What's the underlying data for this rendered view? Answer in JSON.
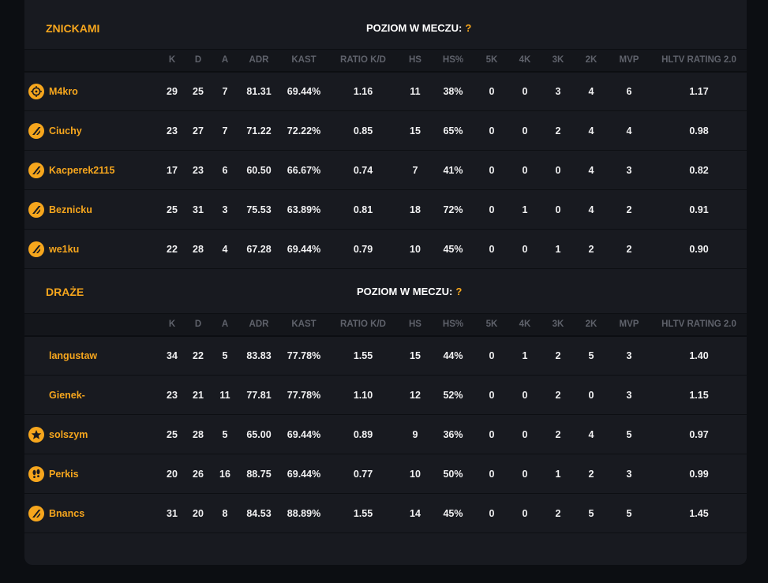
{
  "columns": [
    "K",
    "D",
    "A",
    "ADR",
    "KAST",
    "RATIO K/D",
    "HS",
    "HS%",
    "5K",
    "4K",
    "3K",
    "2K",
    "MVP",
    "HLTV RATING 2.0"
  ],
  "teams": [
    {
      "name": "ZNICKAMI",
      "level_label": "POZIOM W MECZU:",
      "level_value": "?",
      "players": [
        {
          "name": "M4kro",
          "icon": "crosshair-icon",
          "stats": [
            "29",
            "25",
            "7",
            "81.31",
            "69.44%",
            "1.16",
            "11",
            "38%",
            "0",
            "0",
            "3",
            "4",
            "6",
            "1.17"
          ]
        },
        {
          "name": "Ciuchy",
          "icon": "slash-badge-icon",
          "stats": [
            "23",
            "27",
            "7",
            "71.22",
            "72.22%",
            "0.85",
            "15",
            "65%",
            "0",
            "0",
            "2",
            "4",
            "4",
            "0.98"
          ]
        },
        {
          "name": "Kacperek2115",
          "icon": "slash-badge-icon",
          "stats": [
            "17",
            "23",
            "6",
            "60.50",
            "66.67%",
            "0.74",
            "7",
            "41%",
            "0",
            "0",
            "0",
            "4",
            "3",
            "0.82"
          ]
        },
        {
          "name": "Beznicku",
          "icon": "slash-badge-icon",
          "stats": [
            "25",
            "31",
            "3",
            "75.53",
            "63.89%",
            "0.81",
            "18",
            "72%",
            "0",
            "1",
            "0",
            "4",
            "2",
            "0.91"
          ]
        },
        {
          "name": "we1ku",
          "icon": "slash-badge-icon",
          "stats": [
            "22",
            "28",
            "4",
            "67.28",
            "69.44%",
            "0.79",
            "10",
            "45%",
            "0",
            "0",
            "1",
            "2",
            "2",
            "0.90"
          ]
        }
      ]
    },
    {
      "name": "DRAŻE",
      "level_label": "POZIOM W MECZU:",
      "level_value": "?",
      "players": [
        {
          "name": "langustaw",
          "icon": "",
          "stats": [
            "34",
            "22",
            "5",
            "83.83",
            "77.78%",
            "1.55",
            "15",
            "44%",
            "0",
            "1",
            "2",
            "5",
            "3",
            "1.40"
          ]
        },
        {
          "name": "Gienek-",
          "icon": "",
          "stats": [
            "23",
            "21",
            "11",
            "77.81",
            "77.78%",
            "1.10",
            "12",
            "52%",
            "0",
            "0",
            "2",
            "0",
            "3",
            "1.15"
          ]
        },
        {
          "name": "solszym",
          "icon": "star-icon",
          "stats": [
            "25",
            "28",
            "5",
            "65.00",
            "69.44%",
            "0.89",
            "9",
            "36%",
            "0",
            "0",
            "2",
            "4",
            "5",
            "0.97"
          ]
        },
        {
          "name": "Perkis",
          "icon": "footprints-icon",
          "stats": [
            "20",
            "26",
            "16",
            "88.75",
            "69.44%",
            "0.77",
            "10",
            "50%",
            "0",
            "0",
            "1",
            "2",
            "3",
            "0.99"
          ]
        },
        {
          "name": "Bnancs",
          "icon": "slash-badge-icon",
          "stats": [
            "31",
            "20",
            "8",
            "84.53",
            "88.89%",
            "1.55",
            "14",
            "45%",
            "0",
            "0",
            "2",
            "5",
            "5",
            "1.45"
          ]
        }
      ]
    }
  ],
  "colors": {
    "accent": "#f6a61d",
    "panel": "#181a20",
    "background": "#0c0e12"
  }
}
